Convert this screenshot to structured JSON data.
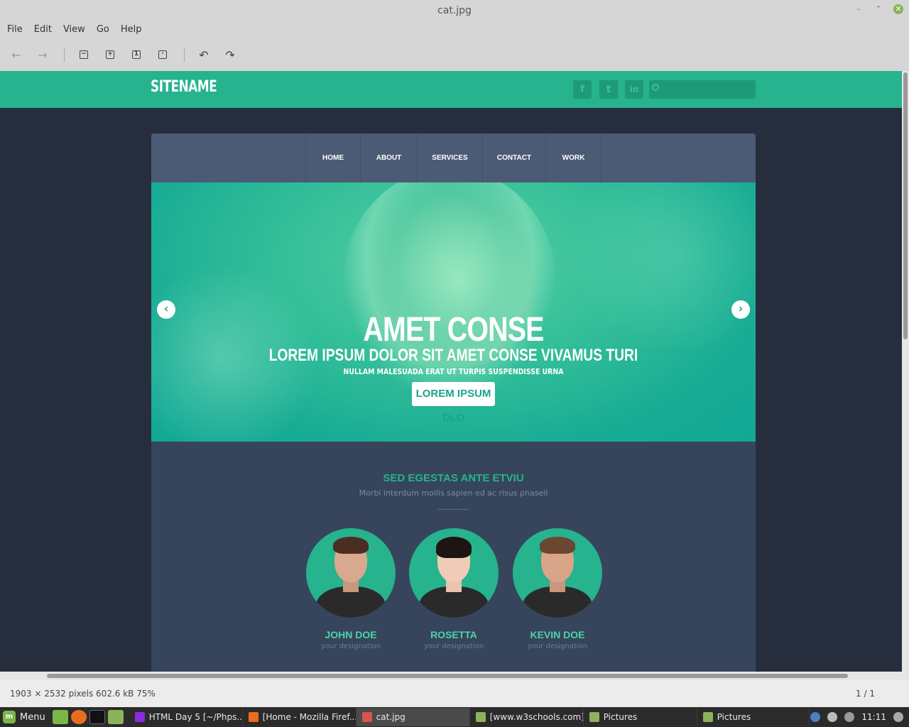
{
  "window": {
    "title": "cat.jpg"
  },
  "menu": [
    "File",
    "Edit",
    "View",
    "Go",
    "Help"
  ],
  "site": {
    "sitename": "SITENAME",
    "nav": [
      "HOME",
      "ABOUT",
      "SERVICES",
      "CONTACT",
      "WORK"
    ],
    "hero": {
      "title": "AMET CONSE",
      "subtitle": "LOREM IPSUM DOLOR SIT AMET CONSE VIVAMUS TURI",
      "small": "NULLAM MALESUADA ERAT UT TURPIS SUSPENDISSE URNA",
      "button": "LOREM IPSUM DLO"
    },
    "team": {
      "heading": "SED EGESTAS ANTE ETVIU",
      "subheading": "Morbi interdum mollis sapien ed ac risus phasell",
      "members": [
        {
          "name": "JOHN DOE",
          "role": "your designation"
        },
        {
          "name": "ROSETTA",
          "role": "your designation"
        },
        {
          "name": "KEVIN DOE",
          "role": "your designation"
        }
      ]
    }
  },
  "status": {
    "info": "1903 × 2532 pixels  602.6 kB   75%",
    "page": "1 / 1"
  },
  "taskbar": {
    "menu_label": "Menu",
    "tasks": [
      "HTML Day 5 [~/Phps...",
      "[Home - Mozilla Firef...",
      "cat.jpg",
      "[www.w3schools.com]",
      "Pictures",
      "Pictures"
    ],
    "clock": "11:11"
  },
  "colors": {
    "header": "#26b38e",
    "accent": "#4fd1a8",
    "card": "#36455b",
    "nav": "#4b5b76",
    "page_bg": "#262e3d"
  }
}
